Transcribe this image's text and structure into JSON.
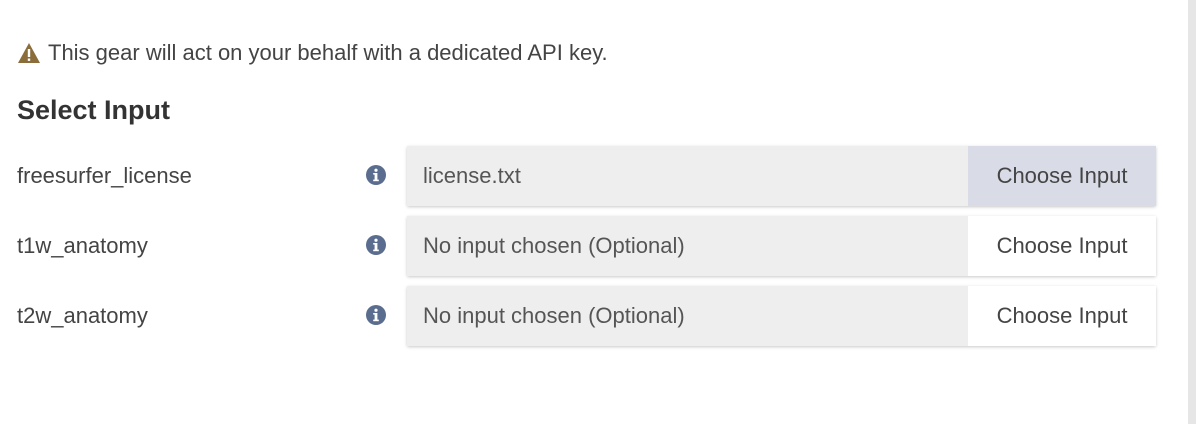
{
  "warning": {
    "text": "This gear will act on your behalf with a dedicated API key.",
    "icon": "warning-triangle-icon",
    "icon_color": "#8a6d3b"
  },
  "section": {
    "title": "Select Input"
  },
  "inputs": [
    {
      "label": "freesurfer_license",
      "info_icon": "info-circle-icon",
      "value": "license.txt",
      "button_label": "Choose Input",
      "button_active": true
    },
    {
      "label": "t1w_anatomy",
      "info_icon": "info-circle-icon",
      "value": "No input chosen (Optional)",
      "button_label": "Choose Input",
      "button_active": false
    },
    {
      "label": "t2w_anatomy",
      "info_icon": "info-circle-icon",
      "value": "No input chosen (Optional)",
      "button_label": "Choose Input",
      "button_active": false
    }
  ],
  "colors": {
    "info_icon": "#5a6d8f",
    "active_button_bg": "#d9dce6",
    "field_bg": "#eeeeee"
  }
}
